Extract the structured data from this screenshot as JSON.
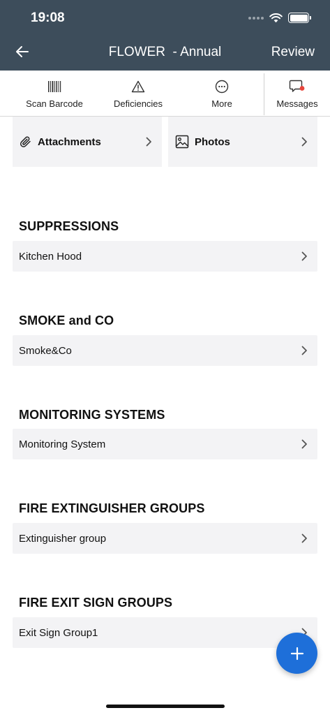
{
  "status_bar": {
    "time": "19:08"
  },
  "nav": {
    "title": "FLOWER  - Annual",
    "review_label": "Review"
  },
  "toolbar": {
    "scan_label": "Scan Barcode",
    "deficiencies_label": "Deficiencies",
    "more_label": "More",
    "messages_label": "Messages",
    "badge_color": "#e8453c"
  },
  "attachments_label": "Attachments",
  "photos_label": "Photos",
  "sections": [
    {
      "title": "SUPPRESSIONS",
      "item": "Kitchen Hood"
    },
    {
      "title": "SMOKE and CO",
      "item": "Smoke&Co"
    },
    {
      "title": "MONITORING SYSTEMS",
      "item": "Monitoring System"
    },
    {
      "title": "FIRE EXTINGUISHER GROUPS",
      "item": "Extinguisher group"
    },
    {
      "title": "FIRE EXIT SIGN GROUPS",
      "item": "Exit Sign Group1"
    }
  ],
  "colors": {
    "header": "#3d4d5b",
    "accent": "#1e6fd9",
    "row_bg": "#f3f3f5"
  }
}
